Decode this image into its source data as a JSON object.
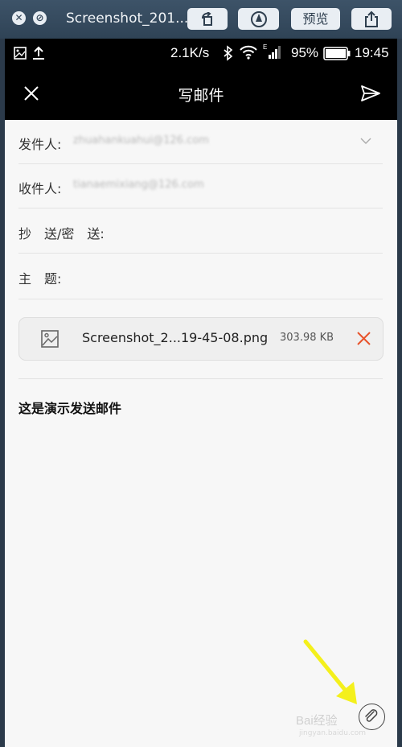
{
  "mac_window": {
    "title": "Screenshot_201...",
    "preview_label": "预览"
  },
  "status_bar": {
    "speed": "2.1K/s",
    "battery_percent": "95%",
    "time": "19:45"
  },
  "app_bar": {
    "title": "写邮件"
  },
  "fields": {
    "sender_label": "发件人:",
    "sender_value": "zhuahankuahui@126.com",
    "recipient_label": "收件人:",
    "recipient_value": "tianaemixiang@126.com",
    "cc_label": "抄　送/密　送:",
    "subject_label": "主　题:"
  },
  "attachment": {
    "name": "Screenshot_2...19-45-08.png",
    "size": "303.98 KB"
  },
  "body": {
    "text": "这是演示发送邮件"
  },
  "watermark": {
    "text": "Bai经验",
    "sub": "jingyan.baidu.com"
  },
  "colors": {
    "accent_red": "#e8532b",
    "arrow_yellow": "#f4f01c"
  }
}
